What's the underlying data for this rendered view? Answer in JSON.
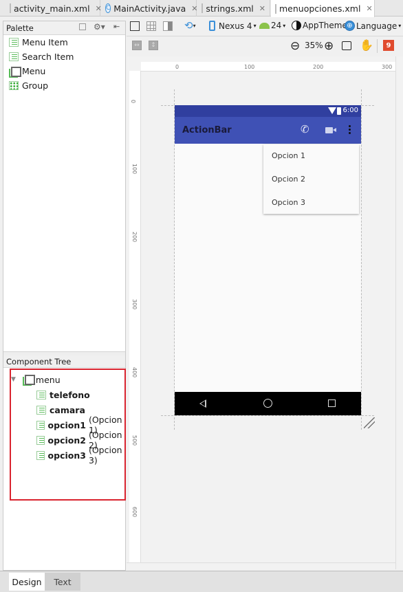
{
  "tabs": [
    {
      "label": "activity_main.xml",
      "icon": "xml-file-icon",
      "active": false
    },
    {
      "label": "MainActivity.java",
      "icon": "java-class-icon",
      "active": false
    },
    {
      "label": "strings.xml",
      "icon": "xml-file-icon",
      "active": false
    },
    {
      "label": "menuopciones.xml",
      "icon": "xml-file-icon",
      "active": true
    }
  ],
  "palette": {
    "title": "Palette",
    "items": [
      {
        "label": "Menu Item",
        "icon": "menu-item-icon"
      },
      {
        "label": "Search Item",
        "icon": "search-item-icon"
      },
      {
        "label": "Menu",
        "icon": "menu-icon"
      },
      {
        "label": "Group",
        "icon": "group-icon"
      }
    ]
  },
  "toolbar": {
    "device": "Nexus 4",
    "api": "24",
    "theme": "AppTheme",
    "language": "Language",
    "zoom": "35%",
    "issues_count": "9"
  },
  "rulers": {
    "top": [
      "0",
      "100",
      "200",
      "300"
    ],
    "left": [
      "0",
      "100",
      "200",
      "300",
      "400",
      "500",
      "600"
    ]
  },
  "phone": {
    "status_time": "6:00",
    "actionbar_title": "ActionBar",
    "overflow_items": [
      "Opcion 1",
      "Opcion 2",
      "Opcion 3"
    ],
    "colors": {
      "statusbar": "#303f9f",
      "actionbar": "#3f51b5",
      "navbar": "#000000"
    }
  },
  "component_tree": {
    "title": "Component Tree",
    "root": "menu",
    "children": [
      {
        "id": "telefono",
        "title": ""
      },
      {
        "id": "camara",
        "title": ""
      },
      {
        "id": "opcion1",
        "title": "(Opcion 1)"
      },
      {
        "id": "opcion2",
        "title": "(Opcion 2)"
      },
      {
        "id": "opcion3",
        "title": "(Opcion 3)"
      }
    ],
    "highlight_color": "#d9232e"
  },
  "bottom_tabs": [
    {
      "label": "Design",
      "active": true
    },
    {
      "label": "Text",
      "active": false
    }
  ]
}
